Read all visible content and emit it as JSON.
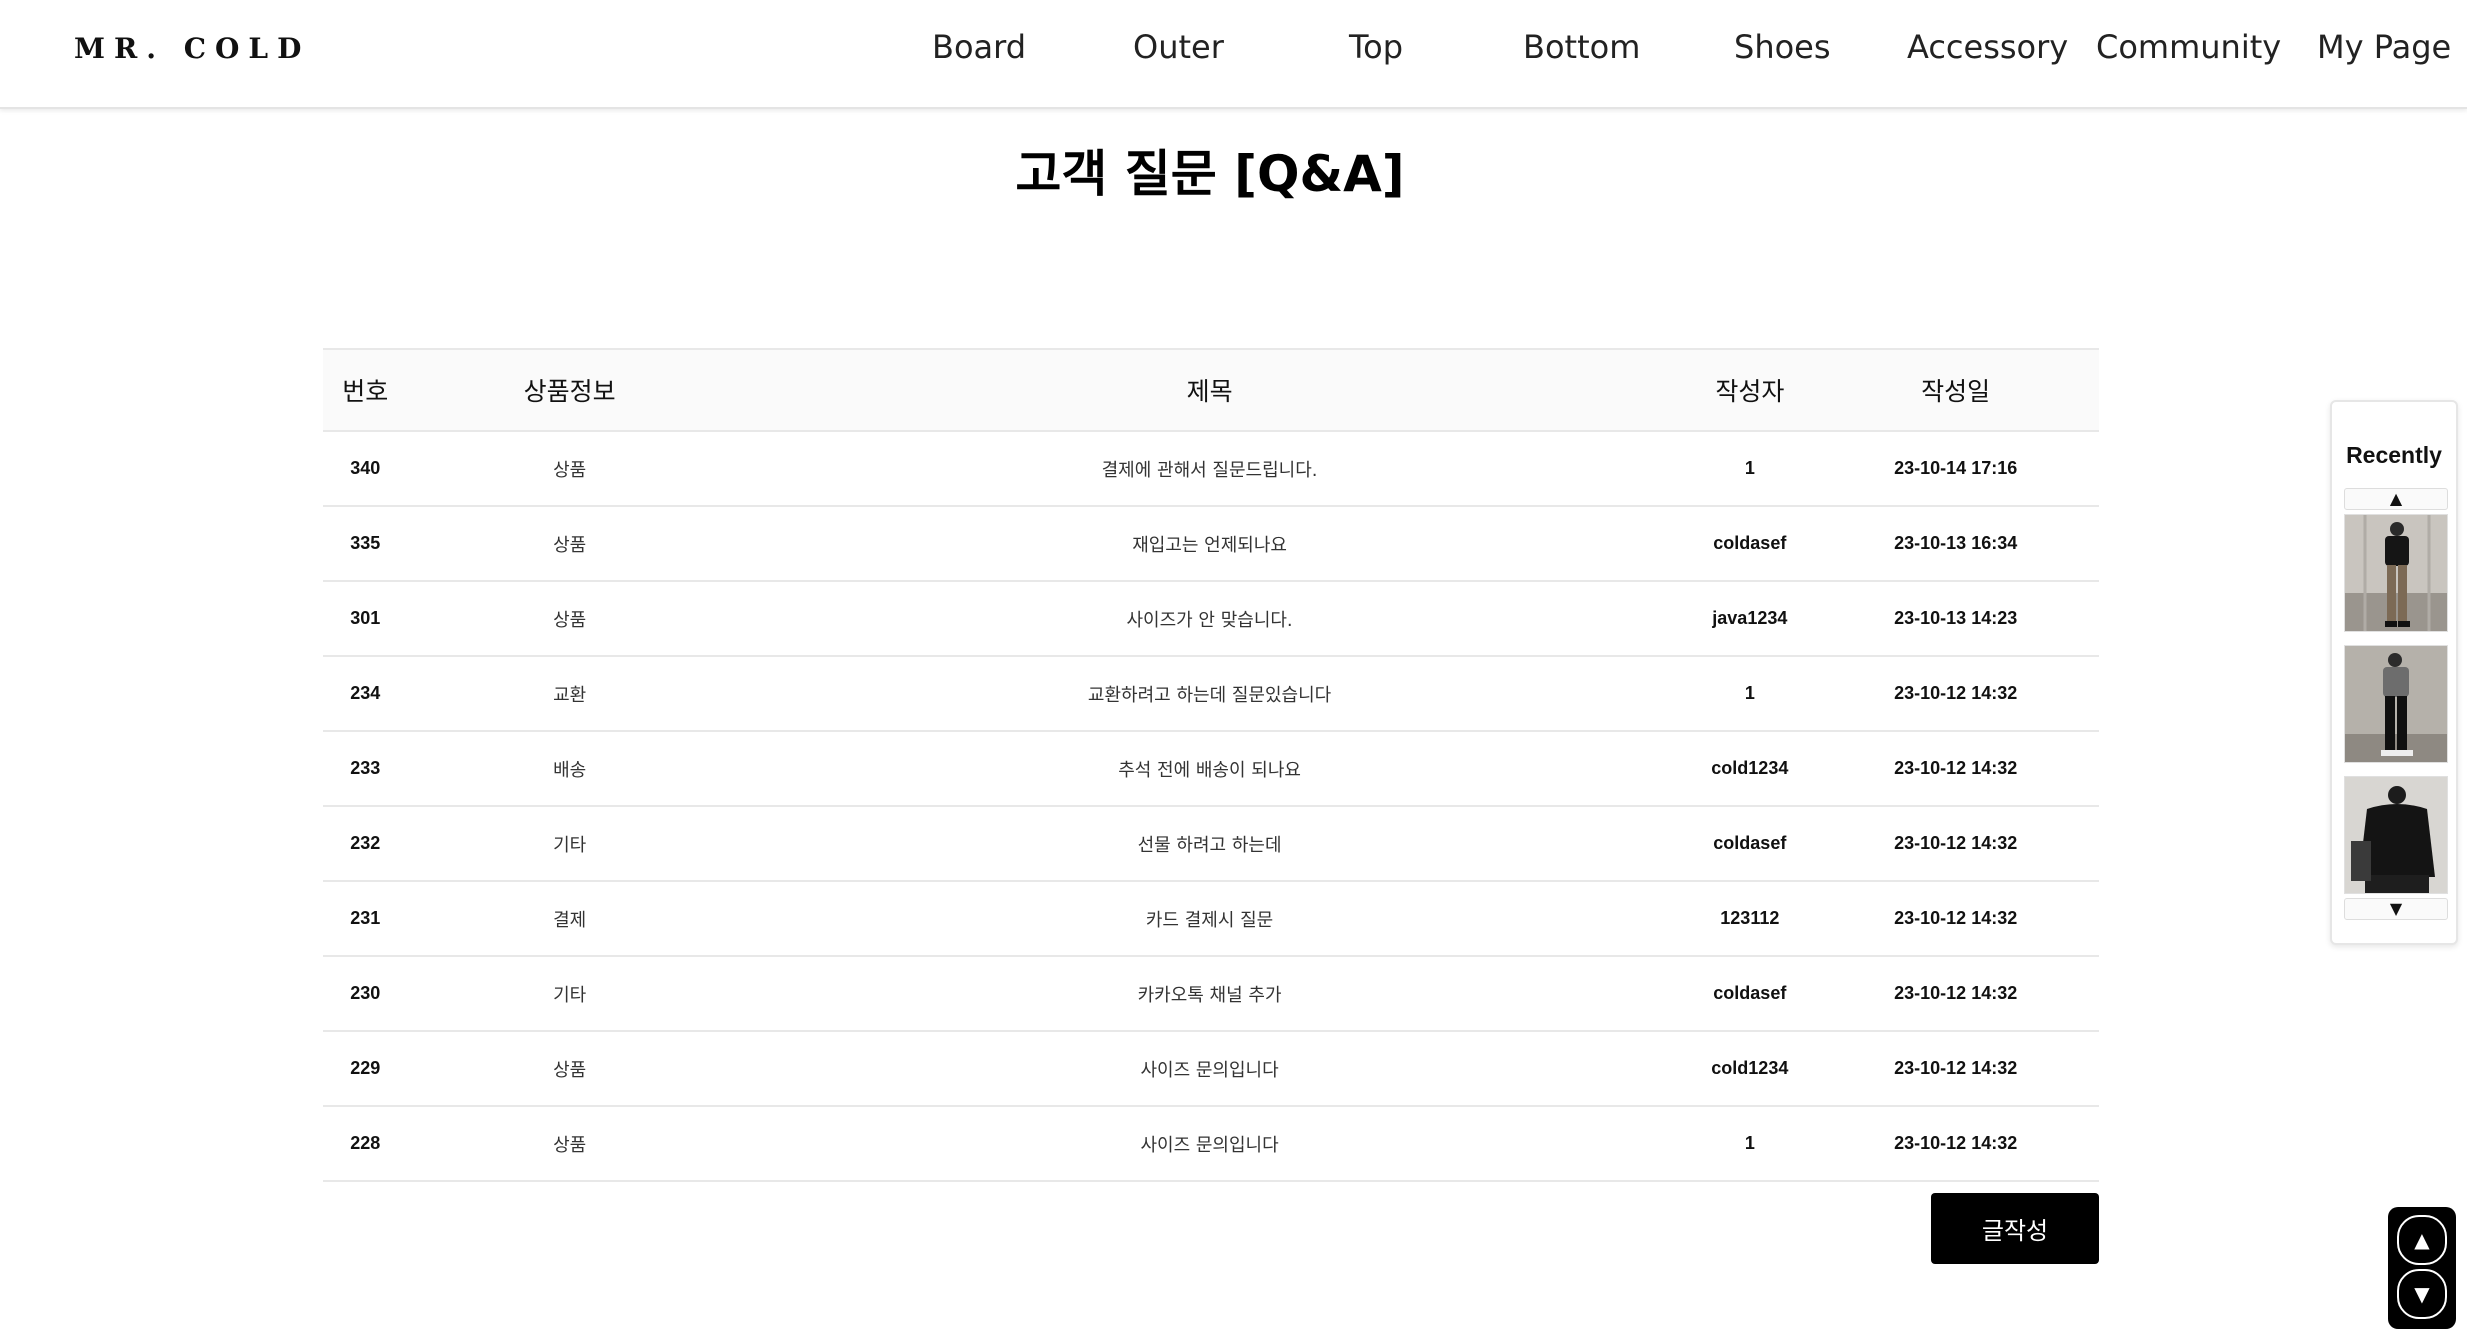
{
  "header": {
    "logo": "MR. COLD",
    "nav": [
      "Board",
      "Outer",
      "Top",
      "Bottom",
      "Shoes",
      "Accessory",
      "Community",
      "My Page"
    ]
  },
  "page_title": "고객 질문 [Q&A]",
  "table": {
    "headers": [
      "번호",
      "상품정보",
      "제목",
      "작성자",
      "작성일"
    ],
    "rows": [
      {
        "num": "340",
        "category": "상품",
        "title": "결제에 관해서 질문드립니다.",
        "author": "1",
        "date": "23-10-14 17:16"
      },
      {
        "num": "335",
        "category": "상품",
        "title": "재입고는 언제되나요",
        "author": "coldasef",
        "date": "23-10-13 16:34"
      },
      {
        "num": "301",
        "category": "상품",
        "title": "사이즈가 안 맞습니다.",
        "author": "java1234",
        "date": "23-10-13 14:23"
      },
      {
        "num": "234",
        "category": "교환",
        "title": "교환하려고 하는데 질문있습니다",
        "author": "1",
        "date": "23-10-12 14:32"
      },
      {
        "num": "233",
        "category": "배송",
        "title": "추석 전에 배송이 되나요",
        "author": "cold1234",
        "date": "23-10-12 14:32"
      },
      {
        "num": "232",
        "category": "기타",
        "title": "선물 하려고 하는데",
        "author": "coldasef",
        "date": "23-10-12 14:32"
      },
      {
        "num": "231",
        "category": "결제",
        "title": "카드 결제시 질문",
        "author": "123112",
        "date": "23-10-12 14:32"
      },
      {
        "num": "230",
        "category": "기타",
        "title": "카카오톡 채널 추가",
        "author": "coldasef",
        "date": "23-10-12 14:32"
      },
      {
        "num": "229",
        "category": "상품",
        "title": "사이즈 문의입니다",
        "author": "cold1234",
        "date": "23-10-12 14:32"
      },
      {
        "num": "228",
        "category": "상품",
        "title": "사이즈 문의입니다",
        "author": "1",
        "date": "23-10-12 14:32"
      }
    ]
  },
  "write_button": "글작성",
  "recently": {
    "title": "Recently",
    "up_arrow": "▲",
    "down_arrow": "▼"
  },
  "scroll": {
    "up": "▲",
    "down": "▼"
  }
}
